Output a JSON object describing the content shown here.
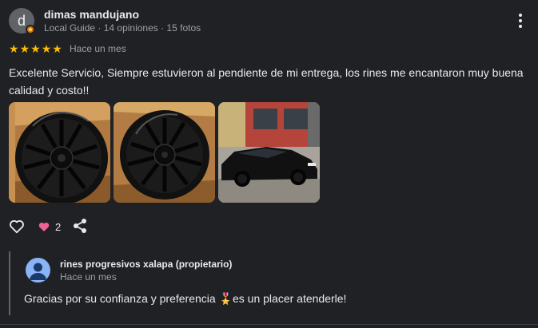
{
  "review": {
    "avatar_letter": "d",
    "author_name": "dimas mandujano",
    "author_meta": "Local Guide · 14 opiniones · 15 fotos",
    "rating": 5,
    "stars": [
      "★",
      "★",
      "★",
      "★",
      "★"
    ],
    "time": "Hace un mes",
    "text": "Excelente Servicio, Siempre estuvieron al pendiente de mi entrega, los rines me encantaron muy buena calidad y costo!!",
    "photos": [
      {
        "subject": "black wheel rim in box"
      },
      {
        "subject": "black wheel rim in box"
      },
      {
        "subject": "black car with new rims"
      }
    ],
    "reaction_count": "2"
  },
  "owner_reply": {
    "name": "rines progresivos xalapa (propietario)",
    "time": "Hace un mes",
    "text": "Gracias por su confianza y preferencia 🎖️es un placer atenderle!"
  },
  "icons": {
    "more": "more-vert-icon",
    "like": "thumb-up-outline-icon",
    "reaction": "heart-icon",
    "share": "share-icon"
  },
  "colors": {
    "background": "#202124",
    "star": "#fbbc04",
    "heart": "#f06292",
    "owner_avatar": "#8ab4f8"
  }
}
